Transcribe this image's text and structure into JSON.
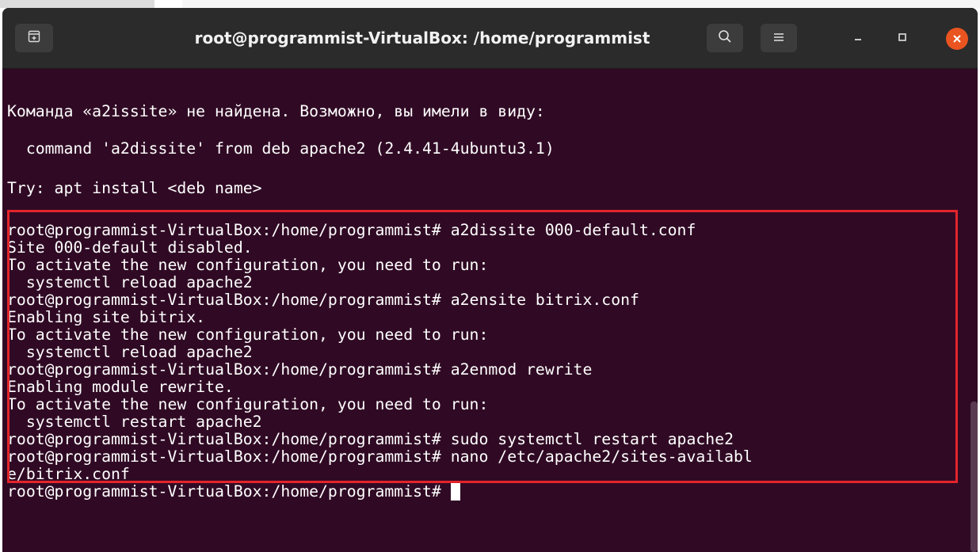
{
  "window": {
    "title": "root@programmist-VirtualBox: /home/programmist",
    "icons": {
      "new_tab": "new-tab-icon",
      "search": "search-icon",
      "menu": "hamburger-menu-icon",
      "minimize": "minimize-icon",
      "maximize": "maximize-icon",
      "close": "close-icon"
    }
  },
  "terminal": {
    "lines": [
      "Команда «a2issite» не найдена. Возможно, вы имели в виду:",
      "  command 'a2dissite' from deb apache2 (2.4.41-4ubuntu3.1)",
      "Try: apt install <deb name>",
      "root@programmist-VirtualBox:/home/programmist# a2dissite 000-default.conf",
      "Site 000-default disabled.",
      "To activate the new configuration, you need to run:",
      "  systemctl reload apache2",
      "root@programmist-VirtualBox:/home/programmist# a2ensite bitrix.conf",
      "Enabling site bitrix.",
      "To activate the new configuration, you need to run:",
      "  systemctl reload apache2",
      "root@programmist-VirtualBox:/home/programmist# a2enmod rewrite",
      "Enabling module rewrite.",
      "To activate the new configuration, you need to run:",
      "  systemctl restart apache2",
      "root@programmist-VirtualBox:/home/programmist# sudo systemctl restart apache2",
      "root@programmist-VirtualBox:/home/programmist# nano /etc/apache2/sites-availabl",
      "e/bitrix.conf",
      "root@programmist-VirtualBox:/home/programmist# "
    ]
  },
  "colors": {
    "terminal_bg": "#300a24",
    "titlebar_bg": "#2b2b2b",
    "close_button": "#e95420",
    "highlight_box": "#e3242b",
    "text": "#ffffff"
  }
}
